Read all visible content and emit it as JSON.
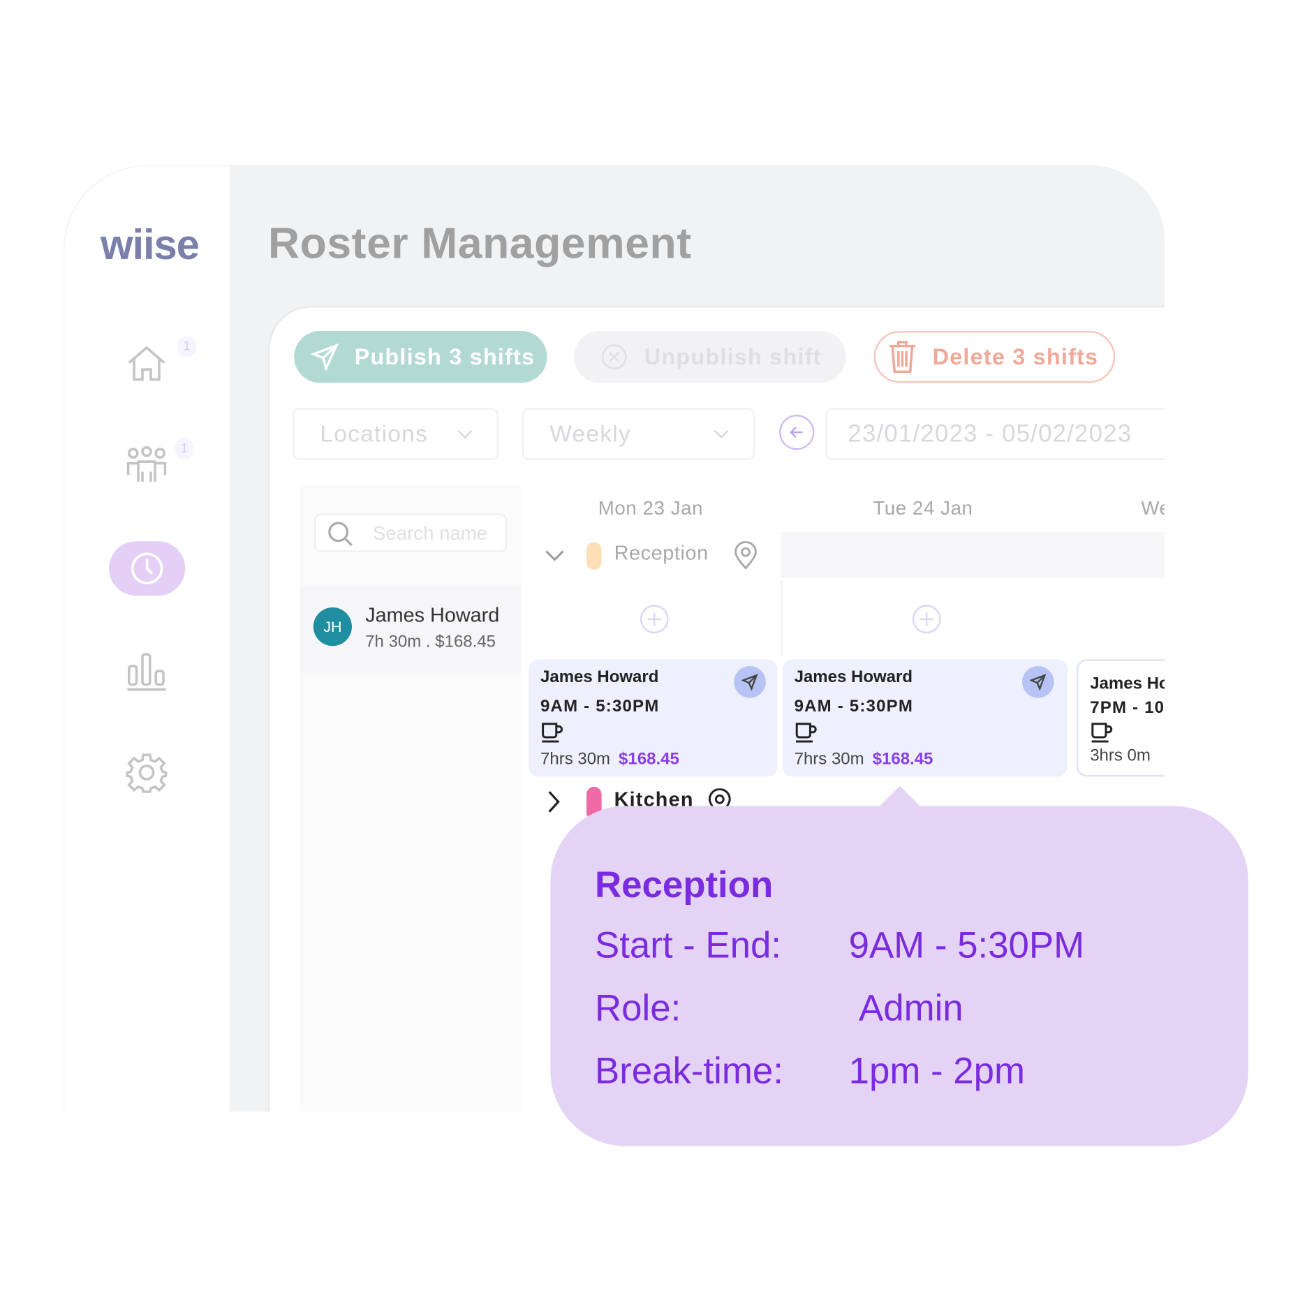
{
  "app": {
    "logo": "wiise",
    "title": "Roster Management"
  },
  "sidebar": {
    "items": [
      {
        "icon": "home-icon",
        "badge": "1"
      },
      {
        "icon": "people-icon",
        "badge": "1"
      },
      {
        "icon": "clock-icon",
        "active": true
      },
      {
        "icon": "bar-chart-icon"
      },
      {
        "icon": "gear-icon"
      }
    ]
  },
  "toolbar": {
    "publish_label": "Publish 3 shifts",
    "unpublish_label": "Unpublish shift",
    "delete_label": "Delete 3 shifts"
  },
  "filters": {
    "locations": "Locations",
    "period": "Weekly",
    "date_range": "23/01/2023 - 05/02/2023"
  },
  "search": {
    "placeholder": "Search name"
  },
  "employee": {
    "initials": "JH",
    "name": "James Howard",
    "summary": "7h 30m . $168.45"
  },
  "days": [
    "Mon 23 Jan",
    "Tue 24 Jan",
    "We"
  ],
  "groups": [
    {
      "name": "Reception",
      "color": "#fde0b8",
      "expanded": true
    },
    {
      "name": "Kitchen",
      "color": "#f06aa8",
      "expanded": false
    }
  ],
  "shifts": [
    {
      "name": "James Howard",
      "time": "9AM - 5:30PM",
      "duration": "7hrs 30m",
      "pay": "$168.45"
    },
    {
      "name": "James Howard",
      "time": "9AM - 5:30PM",
      "duration": "7hrs 30m",
      "pay": "$168.45"
    },
    {
      "name": "James Ho",
      "time": "7PM - 10",
      "duration": "3hrs 0m"
    }
  ],
  "tooltip": {
    "title": "Reception",
    "rows": [
      {
        "label": "Start - End:",
        "value": "9AM - 5:30PM"
      },
      {
        "label": "Role:",
        "value": "Admin"
      },
      {
        "label": "Break-time:",
        "value": "1pm - 2pm"
      }
    ]
  },
  "colors": {
    "accent": "#7a2be0",
    "publish": "#b3d9d3",
    "delete": "#f0a898",
    "tooltip_bg": "#e4d3f5",
    "avatar": "#1f8ea0"
  }
}
